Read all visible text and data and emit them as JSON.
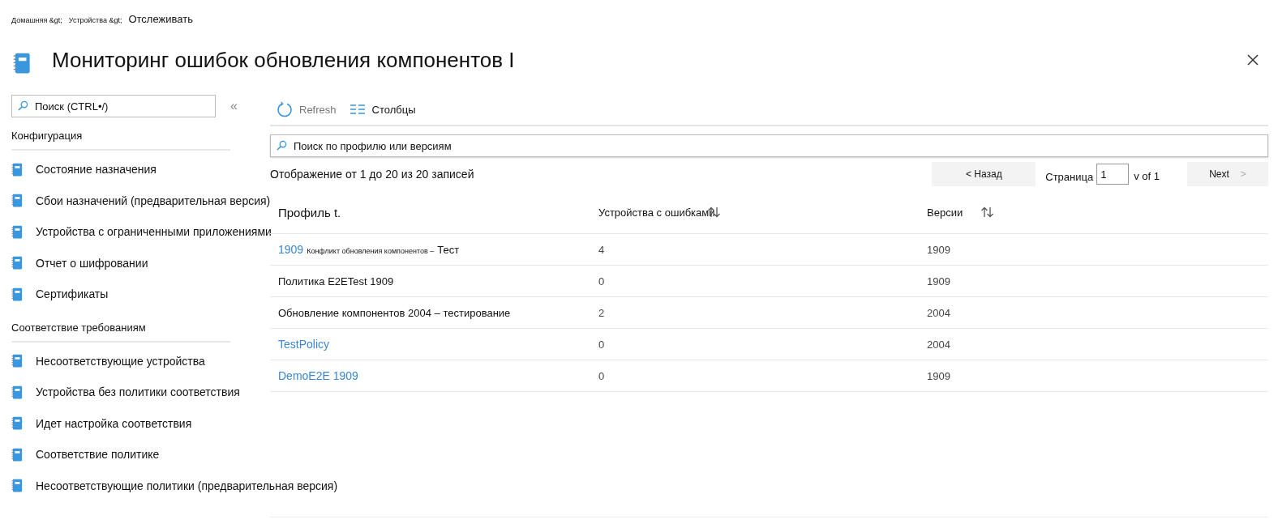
{
  "breadcrumb": [
    {
      "label": "Домашняя &gt;",
      "kind": "small"
    },
    {
      "label": "Устройства &gt;",
      "kind": "small"
    },
    {
      "label": "Отслеживать",
      "kind": "current"
    }
  ],
  "title": "Мониторинг ошибок обновления компонентов I",
  "sidebar": {
    "search": {
      "placeholder": "Поиск (CTRL•/)"
    },
    "collapse": "«",
    "sections": [
      {
        "title": "Конфигурация",
        "items": [
          "Состояние назначения",
          "Сбои назначений (предварительная версия)",
          "Устройства с ограниченными приложениями",
          "Отчет о шифровании",
          "Сертификаты"
        ]
      },
      {
        "title": "Соответствие требованиям",
        "items": [
          "Несоответствующие устройства",
          "Устройства без политики соответствия",
          "Идет настройка соответствия",
          "Соответствие политике",
          "Несоответствующие политики (предварительная версия)"
        ]
      }
    ]
  },
  "toolbar": [
    {
      "label": "Refresh",
      "kind": "refresh",
      "disabled": true
    },
    {
      "label": "Столбцы",
      "kind": "columns",
      "disabled": false
    }
  ],
  "filter": {
    "placeholder": "Поиск по профилю или версиям"
  },
  "summary": "Отображение от 1 до 20 из 20 записей",
  "pager": {
    "prev": "< Назад",
    "page_label": "Страница",
    "page": "1",
    "of": "v of 1",
    "next": "Next",
    "next_arrow": ">"
  },
  "table": {
    "columns": [
      {
        "label": "Профиль t.",
        "sortable": false
      },
      {
        "label": "Устройства с ошибками",
        "sortable": true
      },
      {
        "label": "Версии",
        "sortable": true
      }
    ],
    "rows": [
      {
        "profile": [
          {
            "text": "1909",
            "kind": "link"
          },
          {
            "text": "Конфликт обновления компонентов –",
            "kind": "small"
          },
          {
            "text": "Тест",
            "kind": "plain"
          }
        ],
        "errors": "4",
        "version": "1909"
      },
      {
        "profile": [
          {
            "text": "Политика E2ETest 1909",
            "kind": "plain"
          }
        ],
        "errors": "0",
        "version": "1909"
      },
      {
        "profile": [
          {
            "text": "Обновление компонентов 2004 – тестирование",
            "kind": "plain"
          }
        ],
        "errors": "2",
        "version": "2004"
      },
      {
        "profile": [
          {
            "text": "TestPolicy",
            "kind": "link"
          }
        ],
        "errors": "0",
        "version": "2004"
      },
      {
        "profile": [
          {
            "text": "DemoE2E 1909",
            "kind": "link"
          }
        ],
        "errors": "0",
        "version": "1909"
      }
    ]
  }
}
